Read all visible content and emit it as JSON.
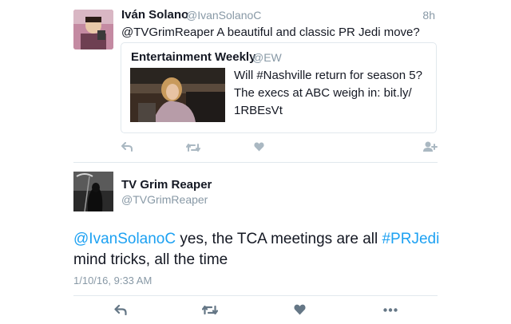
{
  "tweet1": {
    "name": "Iván Solano",
    "handle": "@IvanSolanoC",
    "time": "8h",
    "text": "@TVGrimReaper A beautiful and classic PR Jedi move?",
    "quote": {
      "name": "Entertainment Weekly",
      "handle": "@EW",
      "text": "Will #Nashville return for season 5? The execs at ABC weigh in: bit.ly/ 1RBEsVt"
    },
    "actions": [
      "reply-icon",
      "retweet-icon",
      "like-icon",
      "follow-icon"
    ]
  },
  "tweet2": {
    "name": "TV Grim Reaper",
    "handle": "@TVGrimReaper",
    "mention": "@IvanSolanoC",
    "text_before_hashtag": " yes, the TCA meetings are all ",
    "hashtag": "#PRJedi",
    "text_after_hashtag": " mind tricks, all the time",
    "date": "1/10/16, 9:33 AM",
    "actions": [
      "reply-icon",
      "retweet-icon",
      "like-icon",
      "more-icon"
    ]
  },
  "colors": {
    "link": "#1da1f2",
    "secondary_text": "#8899a6",
    "icon_light": "#aab8c2",
    "icon_dark": "#657786",
    "divider": "#e1e8ed"
  }
}
